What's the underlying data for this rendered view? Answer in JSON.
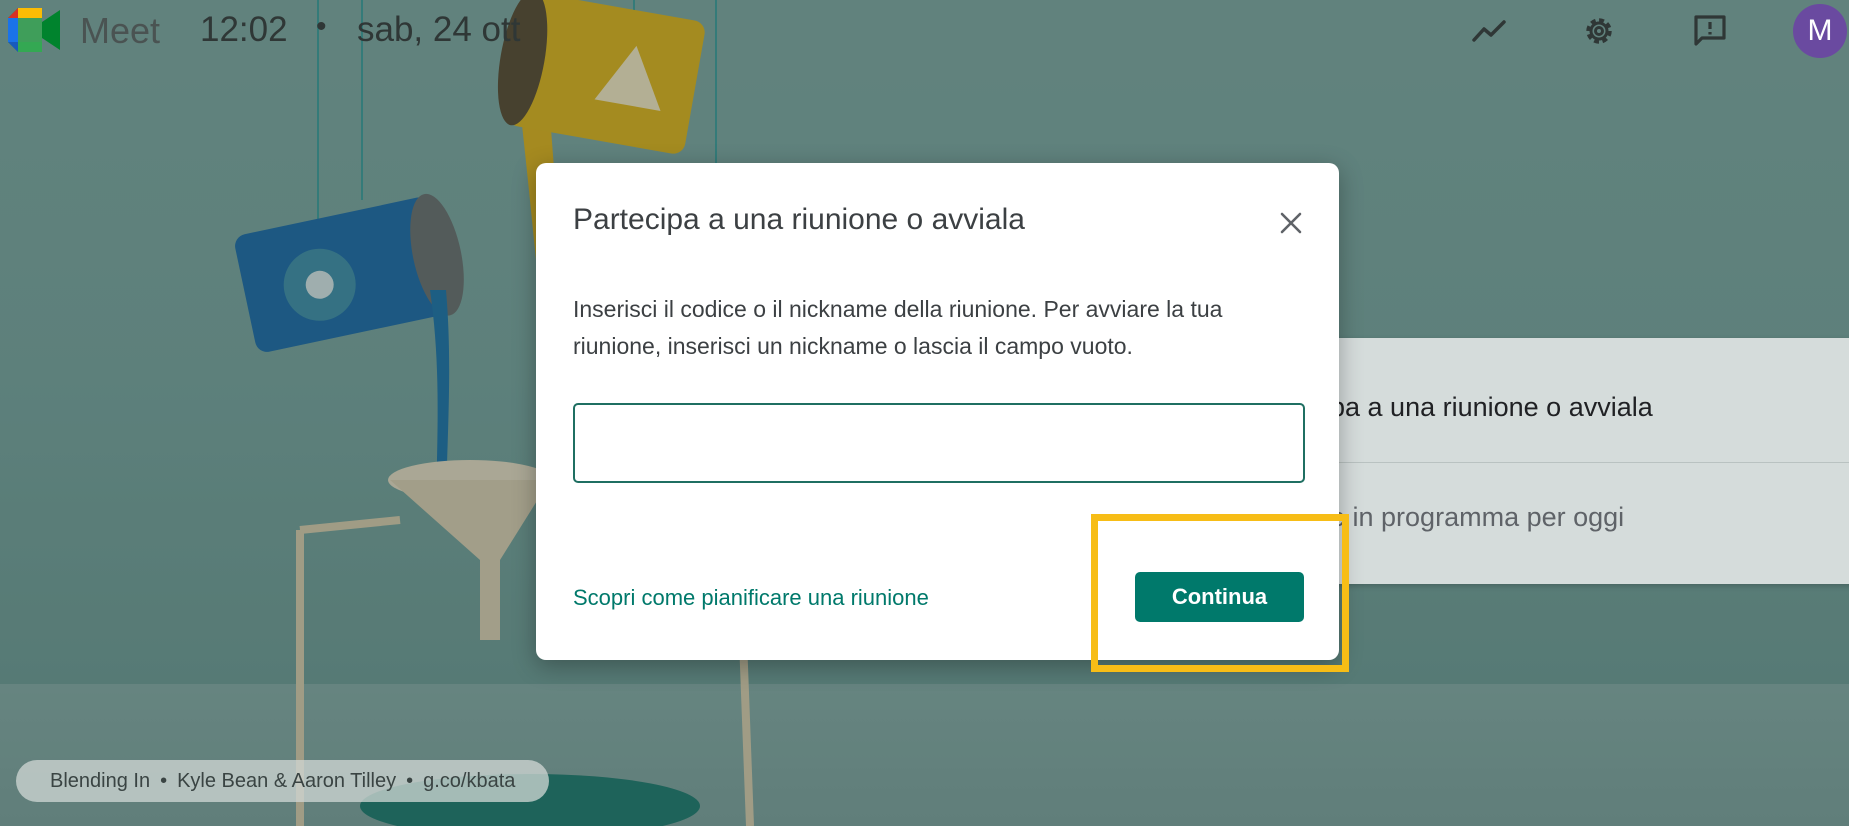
{
  "topbar": {
    "brand": "Meet",
    "time": "12:02",
    "separator": "•",
    "date": "sab, 24 ott",
    "avatar_letter": "M",
    "icons": [
      "activity-chart-icon",
      "gear-icon",
      "feedback-icon"
    ]
  },
  "background_card": {
    "row1": "pa a una riunione o avviala",
    "row2": "e in programma per oggi"
  },
  "dialog": {
    "title": "Partecipa a una riunione o avviala",
    "description": "Inserisci il codice o il nickname della riunione. Per avviare la tua riunione, inserisci un nickname o lascia il campo vuoto.",
    "input_value": "",
    "input_placeholder": "",
    "learn_link": "Scopri come pianificare una riunione",
    "continue_label": "Continua"
  },
  "attribution": {
    "artwork": "Blending In",
    "separator": "•",
    "artists": "Kyle Bean & Aaron Tilley",
    "link": "g.co/kbata"
  },
  "colors": {
    "accent": "#00796b",
    "highlight": "#f7bd16",
    "avatar": "#6a4aa0"
  }
}
